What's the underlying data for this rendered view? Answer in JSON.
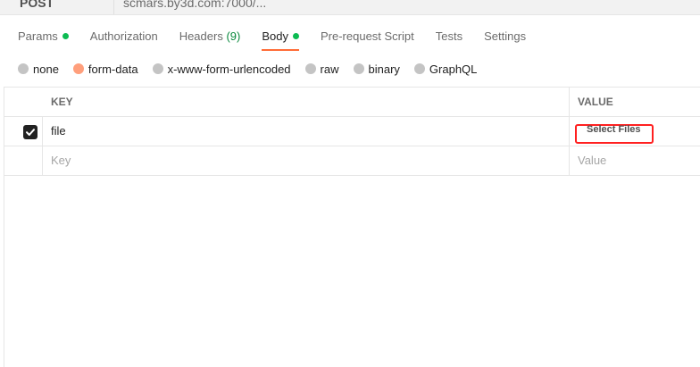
{
  "request": {
    "method": "POST",
    "url": "scmars.by3d.com:7000/..."
  },
  "tabs": [
    {
      "label": "Params",
      "has_dot": true
    },
    {
      "label": "Authorization"
    },
    {
      "label": "Headers",
      "count": "(9)"
    },
    {
      "label": "Body",
      "has_dot": true,
      "active": true
    },
    {
      "label": "Pre-request Script"
    },
    {
      "label": "Tests"
    },
    {
      "label": "Settings"
    }
  ],
  "body_types": [
    {
      "label": "none"
    },
    {
      "label": "form-data",
      "selected": true
    },
    {
      "label": "x-www-form-urlencoded"
    },
    {
      "label": "raw"
    },
    {
      "label": "binary"
    },
    {
      "label": "GraphQL"
    }
  ],
  "table": {
    "headers": {
      "key": "KEY",
      "value": "VALUE"
    },
    "rows": [
      {
        "checked": true,
        "key": "file",
        "value_button": "Select Files"
      }
    ],
    "empty_row": {
      "key_placeholder": "Key",
      "value_placeholder": "Value"
    }
  },
  "colors": {
    "accent": "#ff6c37",
    "status_dot": "#0cbb52",
    "highlight_box": "#ff2020"
  }
}
